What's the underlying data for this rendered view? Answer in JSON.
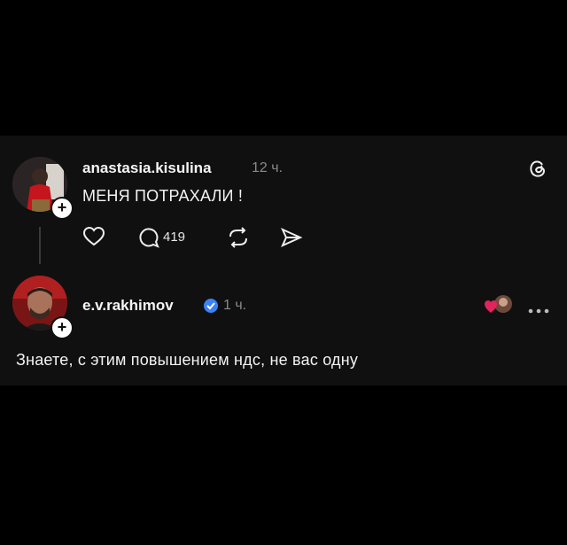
{
  "post": {
    "username": "anastasia.kisulina",
    "time": "12 ч.",
    "text": "МЕНЯ ПОТРАХАЛИ !",
    "reply_count": "419",
    "icons": [
      "heart-icon",
      "comment-icon",
      "repost-icon",
      "share-icon",
      "threads-logo-icon"
    ]
  },
  "reply": {
    "username": "e.v.rakhimov",
    "time": "1 ч.",
    "text": "Знаете, с этим повышением ндс, не вас одну",
    "icons": [
      "verified-icon",
      "liked-by-author-icon",
      "more-icon"
    ]
  },
  "colors": {
    "background": "#000000",
    "card": "#101010",
    "verified": "#3b82f6",
    "heart": "#e0245e"
  }
}
